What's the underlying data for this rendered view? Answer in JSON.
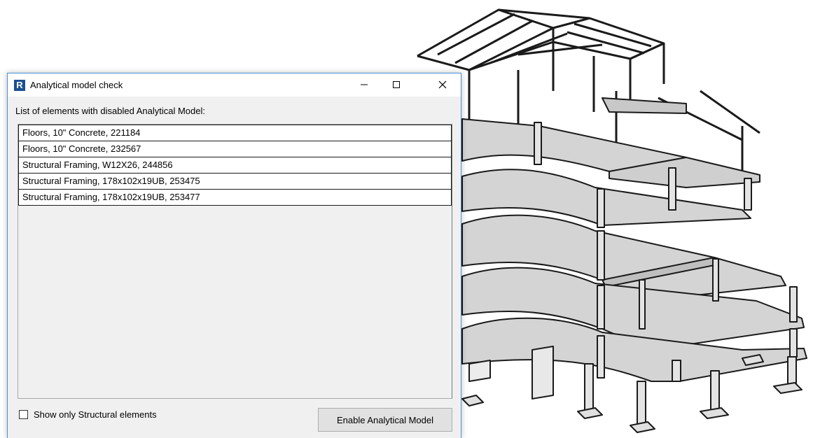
{
  "dialog": {
    "title": "Analytical model check",
    "app_icon_letter": "R",
    "list_label": "List of elements with disabled Analytical Model:",
    "elements": [
      "Floors, 10\" Concrete, 221184",
      "Floors, 10\" Concrete, 232567",
      "Structural Framing, W12X26, 244856",
      "Structural Framing, 178x102x19UB, 253475",
      "Structural Framing, 178x102x19UB, 253477"
    ],
    "checkbox_label": "Show only Structural elements",
    "checkbox_checked": false,
    "enable_button_label": "Enable Analytical Model"
  },
  "window_controls": {
    "minimize_glyph": "—",
    "maximize_glyph": "☐",
    "close_glyph": "✕"
  },
  "colors": {
    "dialog_border": "#4a90d9",
    "dialog_bg": "#f0f0f0",
    "revit_icon": "#1d4f91",
    "slab_fill": "#d4d4d4",
    "structure_stroke": "#1a1a1a"
  }
}
